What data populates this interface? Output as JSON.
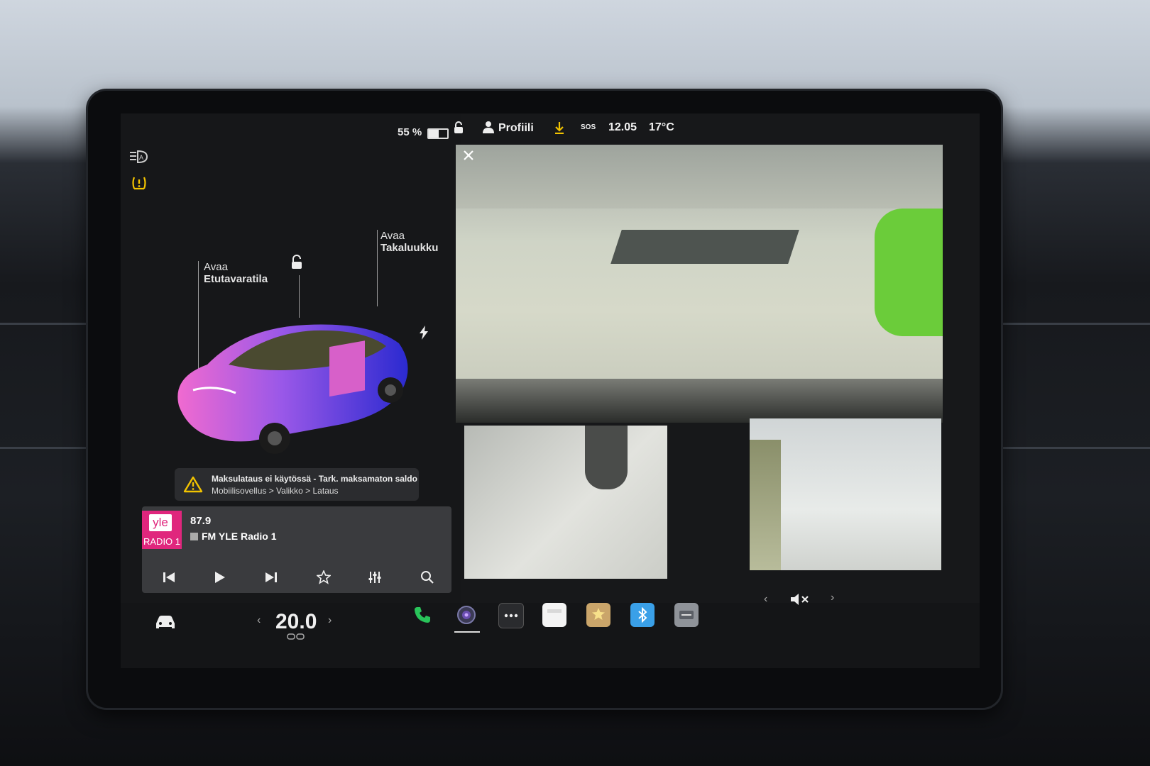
{
  "status": {
    "battery_percent": "55 %",
    "battery_level": 0.55,
    "profile_label": "Profiili",
    "sos_label": "SOS",
    "time": "12.05",
    "outside_temp": "17°C"
  },
  "car_view": {
    "frunk": {
      "action": "Avaa",
      "target": "Etutavaratila"
    },
    "trunk": {
      "action": "Avaa",
      "target": "Takaluukku"
    }
  },
  "alert": {
    "title": "Maksulataus ei käytössä - Tark. maksamaton saldo",
    "path": "Mobiilisovellus > Valikko > Lataus"
  },
  "media": {
    "logo_text": "yle",
    "logo_sub": "RADIO 1",
    "frequency": "87.9",
    "station": "FM YLE Radio 1"
  },
  "climate": {
    "temperature": "20.0"
  },
  "icons": {
    "headlight": "auto-headlight-icon",
    "tpms": "tire-pressure-warning-icon",
    "lock": "lock-icon",
    "profile": "person-icon",
    "download": "download-icon",
    "close": "close-icon",
    "car": "car-icon",
    "phone": "phone-icon",
    "camera": "camera-icon",
    "more": "more-icon",
    "mute": "volume-muted-icon"
  },
  "colors": {
    "accent_yellow": "#f2c300",
    "phone_green": "#29c45a",
    "yle_pink": "#e0267d",
    "bluetooth_blue": "#3aa0e8"
  }
}
